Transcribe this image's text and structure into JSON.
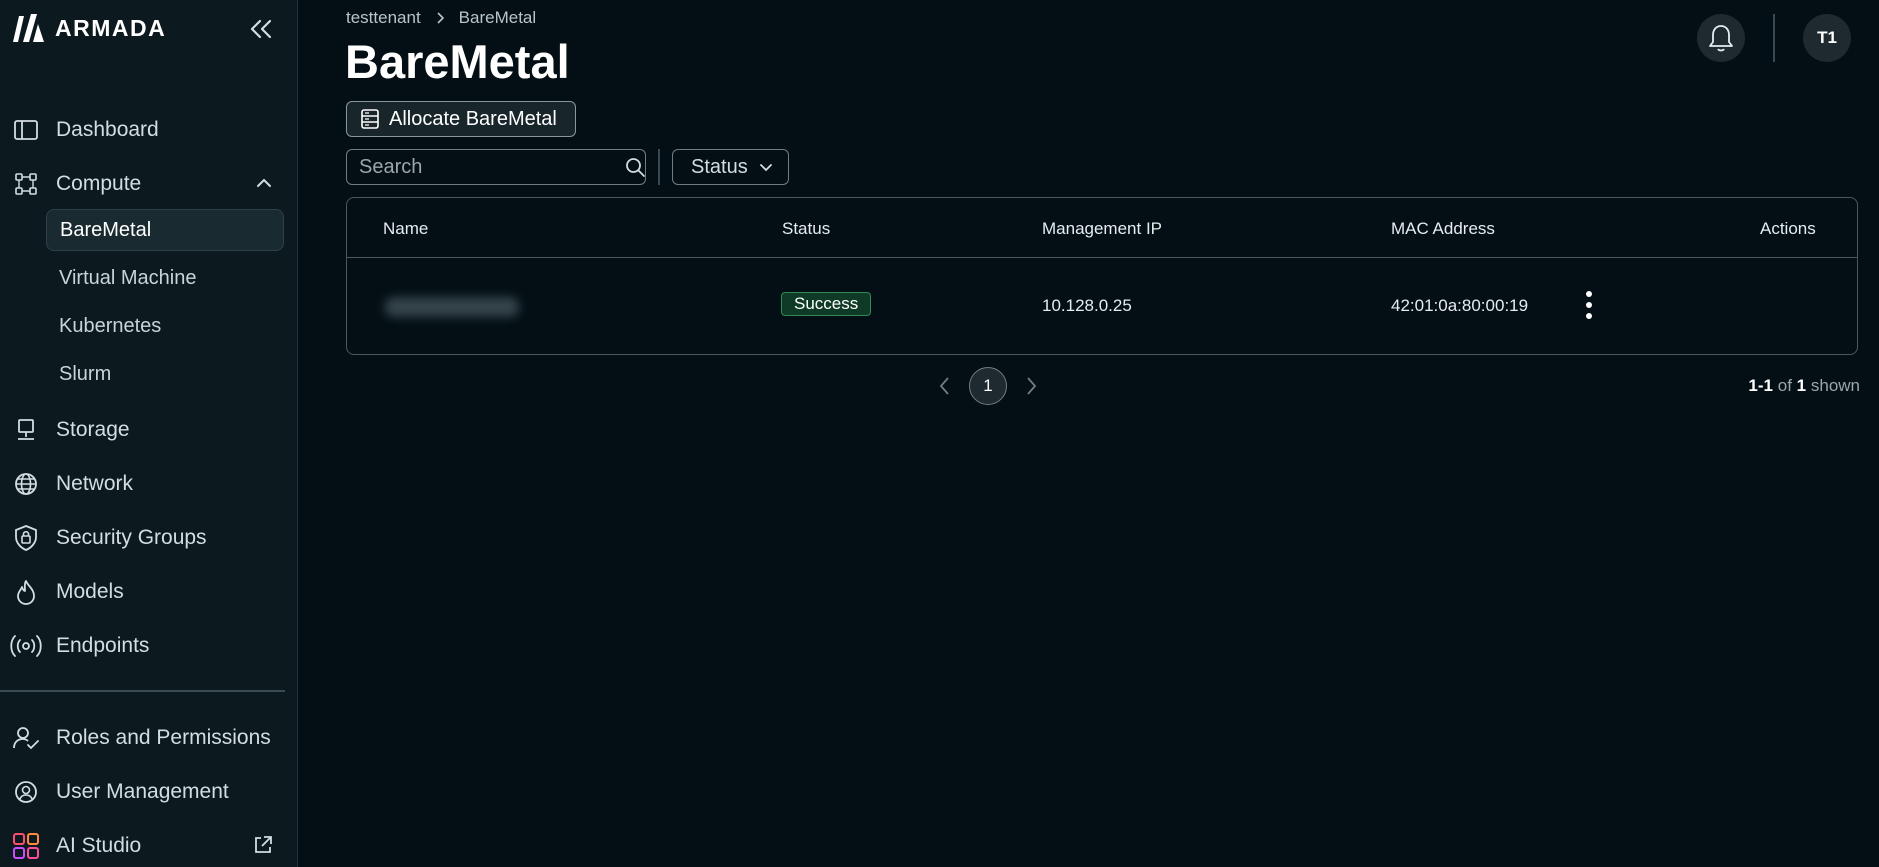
{
  "brand": {
    "name": "ARMADA"
  },
  "sidebar": {
    "items": [
      {
        "label": "Dashboard",
        "icon": "dashboard-icon"
      },
      {
        "label": "Compute",
        "icon": "compute-icon",
        "expanded": true,
        "children": [
          {
            "label": "BareMetal",
            "active": true
          },
          {
            "label": "Virtual Machine"
          },
          {
            "label": "Kubernetes"
          },
          {
            "label": "Slurm"
          }
        ]
      },
      {
        "label": "Storage",
        "icon": "storage-icon"
      },
      {
        "label": "Network",
        "icon": "globe-icon"
      },
      {
        "label": "Security Groups",
        "icon": "shield-lock-icon"
      },
      {
        "label": "Models",
        "icon": "flame-icon"
      },
      {
        "label": "Endpoints",
        "icon": "broadcast-icon"
      }
    ],
    "bottom_items": [
      {
        "label": "Roles and Permissions",
        "icon": "user-check-icon"
      },
      {
        "label": "User Management",
        "icon": "user-circle-icon"
      },
      {
        "label": "AI Studio",
        "icon": "grid-apps-icon",
        "external": true
      }
    ]
  },
  "header": {
    "breadcrumb": [
      "testtenant",
      "BareMetal"
    ],
    "title": "BareMetal",
    "avatar_initials": "T1"
  },
  "toolbar": {
    "allocate_label": "Allocate BareMetal",
    "search_placeholder": "Search",
    "status_filter_label": "Status"
  },
  "table": {
    "columns": [
      "Name",
      "Status",
      "Management IP",
      "MAC Address",
      "Actions"
    ],
    "rows": [
      {
        "name": "",
        "status": "Success",
        "management_ip": "10.128.0.25",
        "mac_address": "42:01:0a:80:00:19"
      }
    ]
  },
  "pagination": {
    "current_page": "1",
    "range": "1-1",
    "of_text": "of",
    "total": "1",
    "shown_text": "shown"
  },
  "colors": {
    "background": "#030f14",
    "sidebar": "#0c1a20",
    "success_bg": "#0f3b26",
    "success_border": "#2f8a59"
  }
}
